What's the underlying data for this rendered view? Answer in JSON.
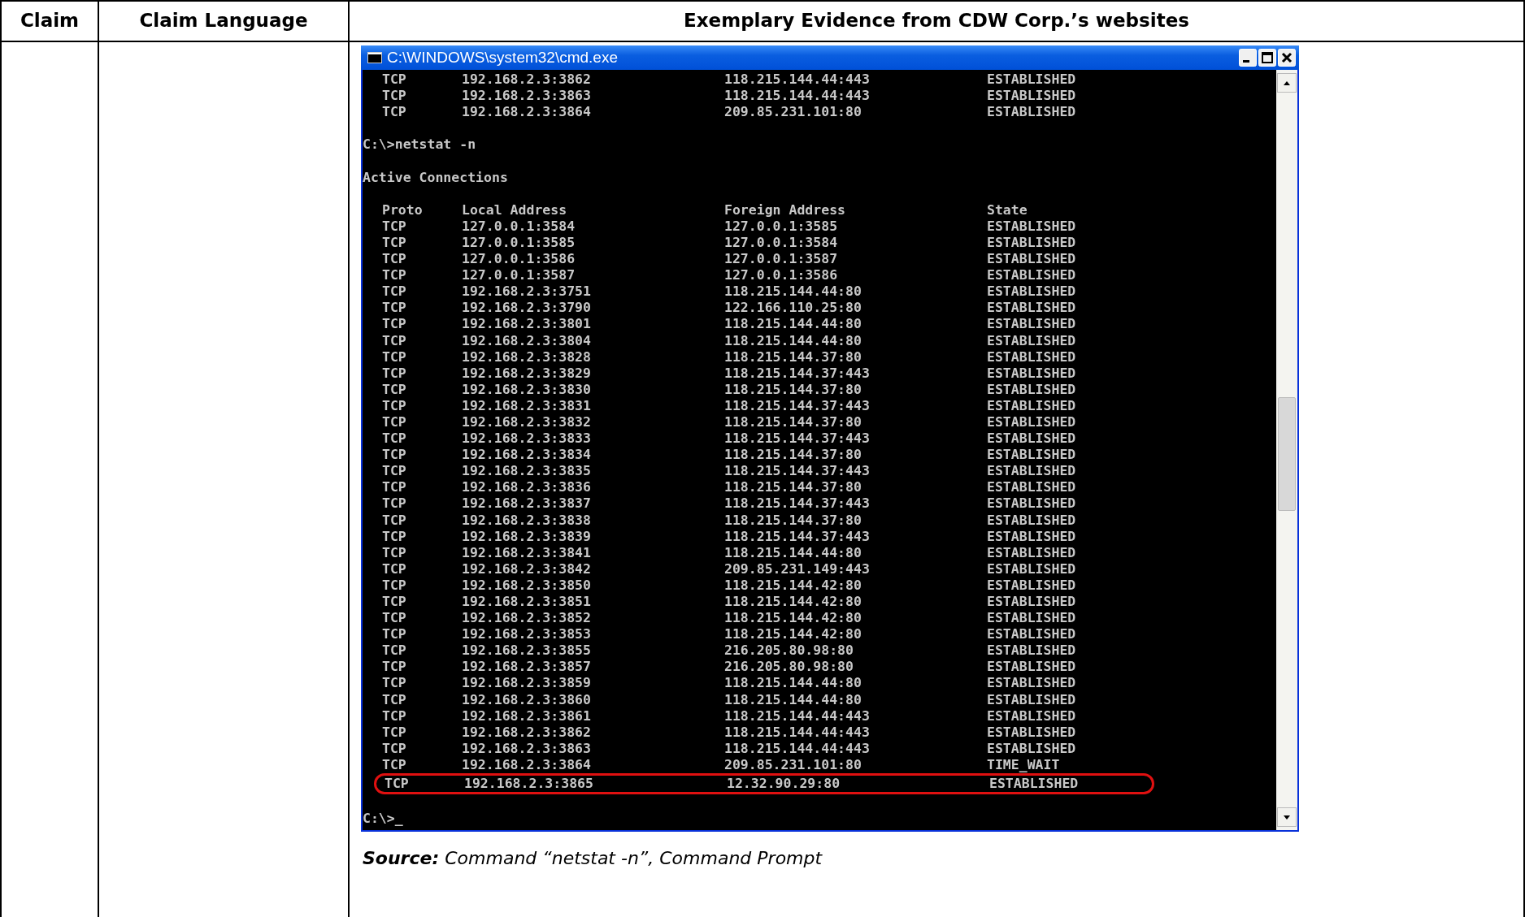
{
  "table": {
    "columns": [
      "Claim",
      "Claim Language",
      "Exemplary Evidence from CDW Corp.’s websites"
    ]
  },
  "console_window": {
    "title": "C:\\WINDOWS\\system32\\cmd.exe",
    "lines": [
      {
        "kind": "row",
        "cells": [
          "TCP",
          "192.168.2.3:3862",
          "118.215.144.44:443",
          "ESTABLISHED"
        ],
        "highlighted": false
      },
      {
        "kind": "row",
        "cells": [
          "TCP",
          "192.168.2.3:3863",
          "118.215.144.44:443",
          "ESTABLISHED"
        ],
        "highlighted": false
      },
      {
        "kind": "row",
        "cells": [
          "TCP",
          "192.168.2.3:3864",
          "209.85.231.101:80",
          "ESTABLISHED"
        ],
        "highlighted": false
      },
      {
        "kind": "blank"
      },
      {
        "kind": "text",
        "text": "C:\\>netstat -n"
      },
      {
        "kind": "blank"
      },
      {
        "kind": "text",
        "text": "Active Connections"
      },
      {
        "kind": "blank"
      },
      {
        "kind": "row",
        "cells": [
          "Proto",
          "Local Address",
          "Foreign Address",
          "State"
        ],
        "highlighted": false
      },
      {
        "kind": "row",
        "cells": [
          "TCP",
          "127.0.0.1:3584",
          "127.0.0.1:3585",
          "ESTABLISHED"
        ],
        "highlighted": false
      },
      {
        "kind": "row",
        "cells": [
          "TCP",
          "127.0.0.1:3585",
          "127.0.0.1:3584",
          "ESTABLISHED"
        ],
        "highlighted": false
      },
      {
        "kind": "row",
        "cells": [
          "TCP",
          "127.0.0.1:3586",
          "127.0.0.1:3587",
          "ESTABLISHED"
        ],
        "highlighted": false
      },
      {
        "kind": "row",
        "cells": [
          "TCP",
          "127.0.0.1:3587",
          "127.0.0.1:3586",
          "ESTABLISHED"
        ],
        "highlighted": false
      },
      {
        "kind": "row",
        "cells": [
          "TCP",
          "192.168.2.3:3751",
          "118.215.144.44:80",
          "ESTABLISHED"
        ],
        "highlighted": false
      },
      {
        "kind": "row",
        "cells": [
          "TCP",
          "192.168.2.3:3790",
          "122.166.110.25:80",
          "ESTABLISHED"
        ],
        "highlighted": false
      },
      {
        "kind": "row",
        "cells": [
          "TCP",
          "192.168.2.3:3801",
          "118.215.144.44:80",
          "ESTABLISHED"
        ],
        "highlighted": false
      },
      {
        "kind": "row",
        "cells": [
          "TCP",
          "192.168.2.3:3804",
          "118.215.144.44:80",
          "ESTABLISHED"
        ],
        "highlighted": false
      },
      {
        "kind": "row",
        "cells": [
          "TCP",
          "192.168.2.3:3828",
          "118.215.144.37:80",
          "ESTABLISHED"
        ],
        "highlighted": false
      },
      {
        "kind": "row",
        "cells": [
          "TCP",
          "192.168.2.3:3829",
          "118.215.144.37:443",
          "ESTABLISHED"
        ],
        "highlighted": false
      },
      {
        "kind": "row",
        "cells": [
          "TCP",
          "192.168.2.3:3830",
          "118.215.144.37:80",
          "ESTABLISHED"
        ],
        "highlighted": false
      },
      {
        "kind": "row",
        "cells": [
          "TCP",
          "192.168.2.3:3831",
          "118.215.144.37:443",
          "ESTABLISHED"
        ],
        "highlighted": false
      },
      {
        "kind": "row",
        "cells": [
          "TCP",
          "192.168.2.3:3832",
          "118.215.144.37:80",
          "ESTABLISHED"
        ],
        "highlighted": false
      },
      {
        "kind": "row",
        "cells": [
          "TCP",
          "192.168.2.3:3833",
          "118.215.144.37:443",
          "ESTABLISHED"
        ],
        "highlighted": false
      },
      {
        "kind": "row",
        "cells": [
          "TCP",
          "192.168.2.3:3834",
          "118.215.144.37:80",
          "ESTABLISHED"
        ],
        "highlighted": false
      },
      {
        "kind": "row",
        "cells": [
          "TCP",
          "192.168.2.3:3835",
          "118.215.144.37:443",
          "ESTABLISHED"
        ],
        "highlighted": false
      },
      {
        "kind": "row",
        "cells": [
          "TCP",
          "192.168.2.3:3836",
          "118.215.144.37:80",
          "ESTABLISHED"
        ],
        "highlighted": false
      },
      {
        "kind": "row",
        "cells": [
          "TCP",
          "192.168.2.3:3837",
          "118.215.144.37:443",
          "ESTABLISHED"
        ],
        "highlighted": false
      },
      {
        "kind": "row",
        "cells": [
          "TCP",
          "192.168.2.3:3838",
          "118.215.144.37:80",
          "ESTABLISHED"
        ],
        "highlighted": false
      },
      {
        "kind": "row",
        "cells": [
          "TCP",
          "192.168.2.3:3839",
          "118.215.144.37:443",
          "ESTABLISHED"
        ],
        "highlighted": false
      },
      {
        "kind": "row",
        "cells": [
          "TCP",
          "192.168.2.3:3841",
          "118.215.144.44:80",
          "ESTABLISHED"
        ],
        "highlighted": false
      },
      {
        "kind": "row",
        "cells": [
          "TCP",
          "192.168.2.3:3842",
          "209.85.231.149:443",
          "ESTABLISHED"
        ],
        "highlighted": false
      },
      {
        "kind": "row",
        "cells": [
          "TCP",
          "192.168.2.3:3850",
          "118.215.144.42:80",
          "ESTABLISHED"
        ],
        "highlighted": false
      },
      {
        "kind": "row",
        "cells": [
          "TCP",
          "192.168.2.3:3851",
          "118.215.144.42:80",
          "ESTABLISHED"
        ],
        "highlighted": false
      },
      {
        "kind": "row",
        "cells": [
          "TCP",
          "192.168.2.3:3852",
          "118.215.144.42:80",
          "ESTABLISHED"
        ],
        "highlighted": false
      },
      {
        "kind": "row",
        "cells": [
          "TCP",
          "192.168.2.3:3853",
          "118.215.144.42:80",
          "ESTABLISHED"
        ],
        "highlighted": false
      },
      {
        "kind": "row",
        "cells": [
          "TCP",
          "192.168.2.3:3855",
          "216.205.80.98:80",
          "ESTABLISHED"
        ],
        "highlighted": false
      },
      {
        "kind": "row",
        "cells": [
          "TCP",
          "192.168.2.3:3857",
          "216.205.80.98:80",
          "ESTABLISHED"
        ],
        "highlighted": false
      },
      {
        "kind": "row",
        "cells": [
          "TCP",
          "192.168.2.3:3859",
          "118.215.144.44:80",
          "ESTABLISHED"
        ],
        "highlighted": false
      },
      {
        "kind": "row",
        "cells": [
          "TCP",
          "192.168.2.3:3860",
          "118.215.144.44:80",
          "ESTABLISHED"
        ],
        "highlighted": false
      },
      {
        "kind": "row",
        "cells": [
          "TCP",
          "192.168.2.3:3861",
          "118.215.144.44:443",
          "ESTABLISHED"
        ],
        "highlighted": false
      },
      {
        "kind": "row",
        "cells": [
          "TCP",
          "192.168.2.3:3862",
          "118.215.144.44:443",
          "ESTABLISHED"
        ],
        "highlighted": false
      },
      {
        "kind": "row",
        "cells": [
          "TCP",
          "192.168.2.3:3863",
          "118.215.144.44:443",
          "ESTABLISHED"
        ],
        "highlighted": false
      },
      {
        "kind": "row",
        "cells": [
          "TCP",
          "192.168.2.3:3864",
          "209.85.231.101:80",
          "TIME_WAIT"
        ],
        "highlighted": false
      },
      {
        "kind": "row",
        "cells": [
          "TCP",
          "192.168.2.3:3865",
          "12.32.90.29:80",
          "ESTABLISHED"
        ],
        "highlighted": true
      },
      {
        "kind": "blank"
      },
      {
        "kind": "text",
        "text": "C:\\>_"
      }
    ]
  },
  "caption": "**Source:** Command “netstat -n”, Command Prompt"
}
